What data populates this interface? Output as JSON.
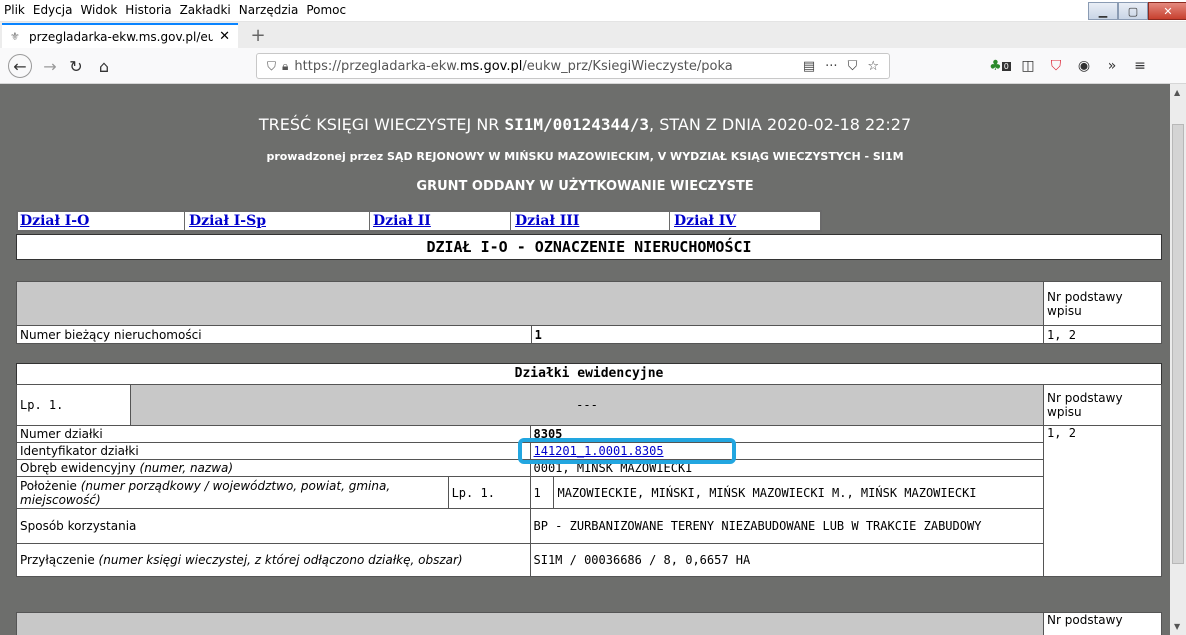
{
  "menu": [
    "Plik",
    "Edycja",
    "Widok",
    "Historia",
    "Zakładki",
    "Narzędzia",
    "Pomoc"
  ],
  "tab": {
    "title": "przegladarka-ekw.ms.gov.pl/eu",
    "close": "✕"
  },
  "nav": {
    "url_prefix": "https://przegladarka-ekw.",
    "url_domain": "ms.gov.pl",
    "url_suffix": "/eukw_prz/KsiegiWieczyste/poka",
    "more": "···"
  },
  "toolbar": {
    "badge": "0",
    "overflow": "»",
    "menu": "≡"
  },
  "header": {
    "line1_a": "TREŚĆ KSIĘGI WIECZYSTEJ NR ",
    "line1_nr": "SI1M/00124344/3",
    "line1_b": ", STAN Z DNIA 2020-02-18 22:27",
    "line2": "prowadzonej przez SĄD REJONOWY W MIŃSKU MAZOWIECKIM, V WYDZIAŁ KSIĄG WIECZYSTYCH - SI1M",
    "line3": "GRUNT ODDANY W UŻYTKOWANIE WIECZYSTE"
  },
  "sections": [
    "Dział I-O",
    "Dział I-Sp",
    "Dział II",
    "Dział III",
    "Dział IV"
  ],
  "section_title": "DZIAŁ I-O - OZNACZENIE NIERUCHOMOŚCI",
  "t1": {
    "nr_podstawy": "Nr podstawy wpisu",
    "row_label": "Numer bieżący nieruchomości",
    "row_value": "1",
    "row_ref": "1, 2"
  },
  "dzialki": {
    "title": "Działki ewidencyjne",
    "lp": "Lp. 1.",
    "dashes": "---",
    "nr_podstawy": "Nr podstawy wpisu",
    "ref": "1, 2",
    "numer_label": "Numer działki",
    "numer_value": "8305",
    "id_label": "Identyfikator działki",
    "id_value": "141201_1.0001.8305",
    "obreb_label": "Obręb ewidencyjny ",
    "obreb_italic": "(numer, nazwa)",
    "obreb_value": "0001, MIŃSK MAZOWIECKI",
    "pol_label": "Położenie ",
    "pol_italic": "(numer porządkowy / województwo, powiat, gmina, miejscowość)",
    "pol_lp": "Lp. 1.",
    "pol_num": "1",
    "pol_value": "MAZOWIECKIE, MIŃSKI, MIŃSK MAZOWIECKI M., MIŃSK MAZOWIECKI",
    "sposob_label": "Sposób korzystania",
    "sposob_value": "BP - ZURBANIZOWANE TERENY NIEZABUDOWANE LUB W TRAKCIE ZABUDOWY",
    "przyl_label": "Przyłączenie ",
    "przyl_italic": "(numer księgi wieczystej, z której odłączono działkę, obszar)",
    "przyl_value": "SI1M / 00036686 / 8, 0,6657 HA"
  },
  "bottom": {
    "nr_podstawy": "Nr podstawy"
  }
}
